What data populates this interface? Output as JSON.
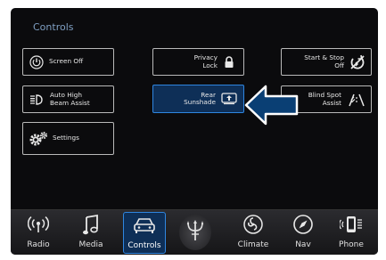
{
  "page": {
    "title": "Controls"
  },
  "buttons": {
    "screen_off": "Screen Off",
    "privacy_lock": "Privacy Lock",
    "start_stop": "Start & Stop Off",
    "auto_high_beam": "Auto High Beam Assist",
    "rear_sunshade": "Rear Sunshade",
    "blind_spot": "Blind Spot Assist",
    "settings": "Settings"
  },
  "nav": {
    "items": [
      {
        "label": "Radio",
        "icon": "radio-icon"
      },
      {
        "label": "Media",
        "icon": "music-note-icon"
      },
      {
        "label": "Controls",
        "icon": "car-icon",
        "active": true
      },
      {
        "label": "",
        "icon": "trident-logo-icon"
      },
      {
        "label": "Climate",
        "icon": "fan-icon"
      },
      {
        "label": "Nav",
        "icon": "compass-icon"
      },
      {
        "label": "Phone",
        "icon": "phone-icon"
      }
    ]
  },
  "colors": {
    "accent": "#2f86e0",
    "highlight_bg": "#0e2f57",
    "title": "#7f9fc2",
    "arrow_fill": "#0a3f74"
  }
}
